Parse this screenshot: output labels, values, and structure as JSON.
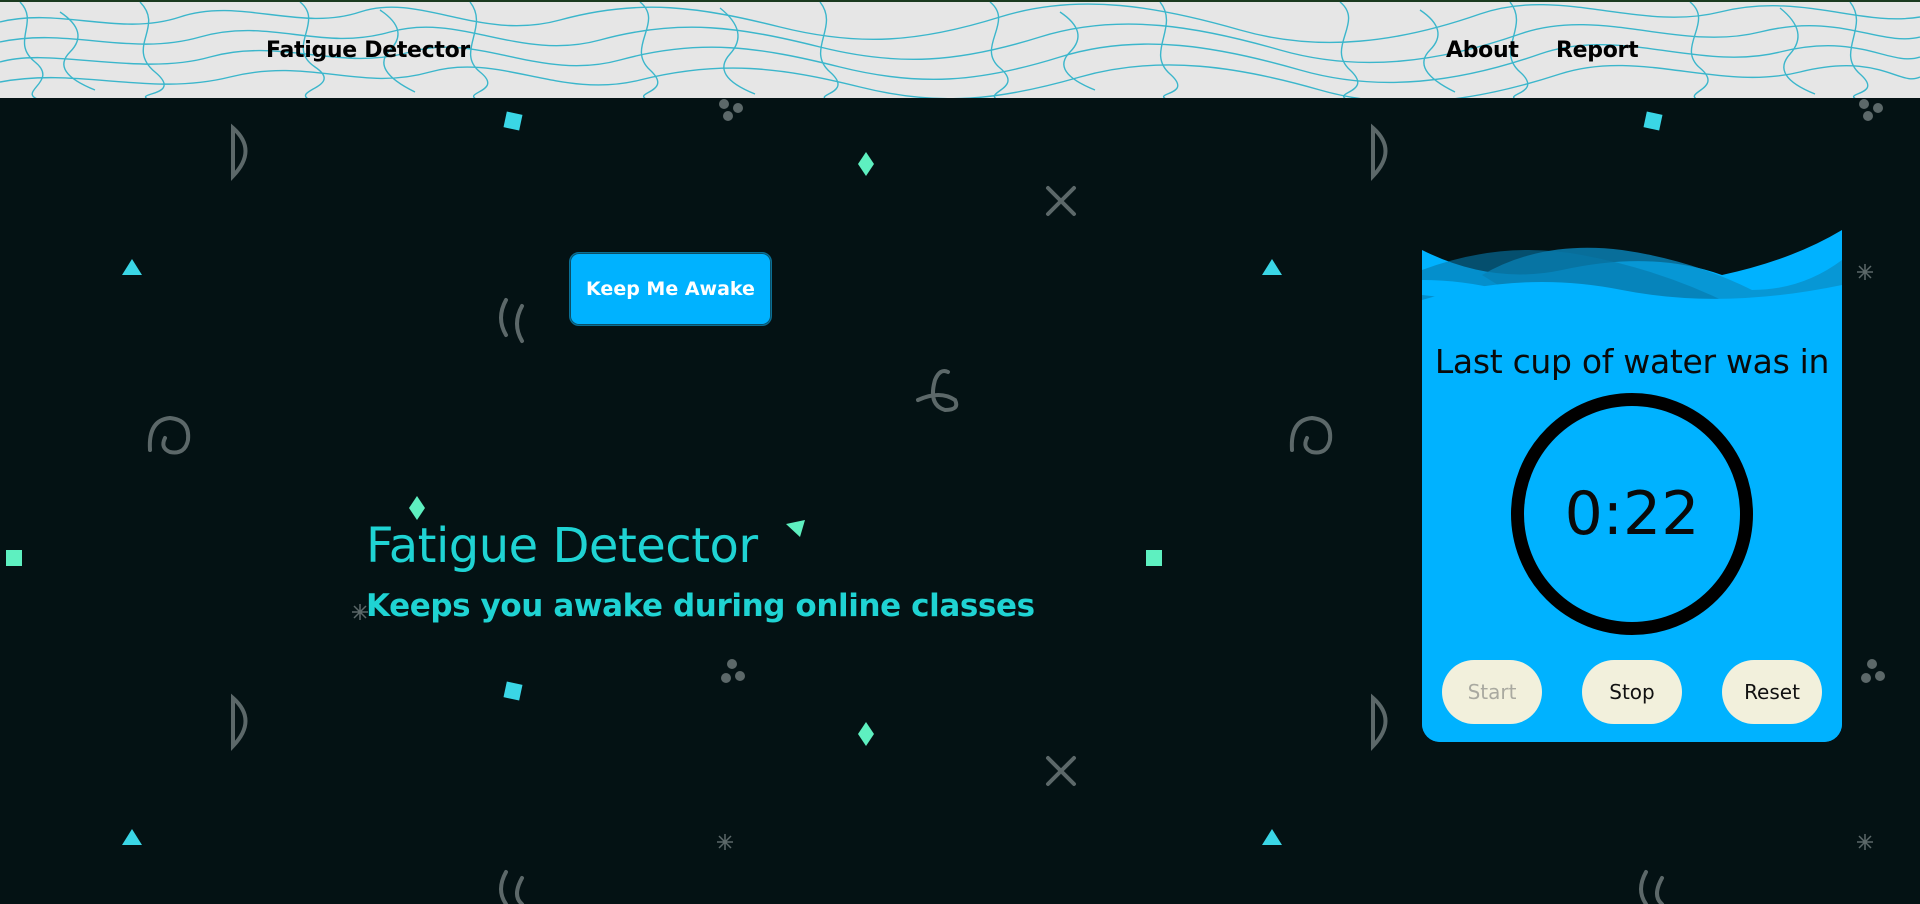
{
  "navbar": {
    "brand": "Fatigue Detector",
    "links": [
      {
        "label": "About"
      },
      {
        "label": "Report"
      }
    ]
  },
  "main": {
    "awake_button": "Keep Me Awake",
    "hero_title": "Fatigue Detector",
    "hero_subtitle": "Keeps you awake during online classes"
  },
  "water_card": {
    "title": "Last cup of water was in",
    "timer": "0:22",
    "buttons": {
      "start": "Start",
      "stop": "Stop",
      "reset": "Reset"
    },
    "start_disabled": true
  },
  "colors": {
    "background": "#041214",
    "navbar": "#e6e6e6",
    "topo_lines": "#29b1c9",
    "accent": "#00b2ff",
    "hero_text": "#1fd3d3",
    "button_bg": "#f2f0dc"
  }
}
